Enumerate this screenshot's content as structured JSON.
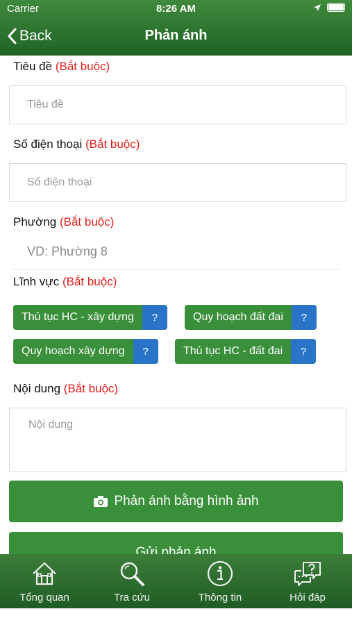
{
  "status": {
    "carrier": "Carrier",
    "time": "8:26 AM"
  },
  "nav": {
    "back_label": "Back",
    "title": "Phản ánh"
  },
  "form": {
    "required_text": "(Bắt buộc)",
    "title_label": "Tiêu đề",
    "title_placeholder": "Tiêu đề",
    "phone_label": "Số điện thoại",
    "phone_placeholder": "Số điện thoại",
    "ward_label": "Phường",
    "ward_placeholder": "VD: Phường 8",
    "field_label": "Lĩnh vực",
    "fields": [
      {
        "label": "Thủ tục HC - xây dựng",
        "help": "?"
      },
      {
        "label": "Quy hoạch đất đai",
        "help": "?"
      },
      {
        "label": "Quy hoạch xây dựng",
        "help": "?"
      },
      {
        "label": "Thủ tục HC - đất đai",
        "help": "?"
      }
    ],
    "content_label": "Nội dung",
    "content_placeholder": "Nội dung",
    "photo_button": "Phản ánh bằng hình ảnh",
    "submit_button": "Gửi phản ánh"
  },
  "tabs": [
    {
      "label": "Tổng quan",
      "icon": "house-icon"
    },
    {
      "label": "Tra cứu",
      "icon": "magnifier-icon"
    },
    {
      "label": "Thông tin",
      "icon": "info-icon"
    },
    {
      "label": "Hỏi đáp",
      "icon": "chat-question-icon"
    }
  ],
  "colors": {
    "header": "#2e7530",
    "chip": "#3a8f3a",
    "help": "#2a74c7",
    "required": "#e0201c"
  }
}
